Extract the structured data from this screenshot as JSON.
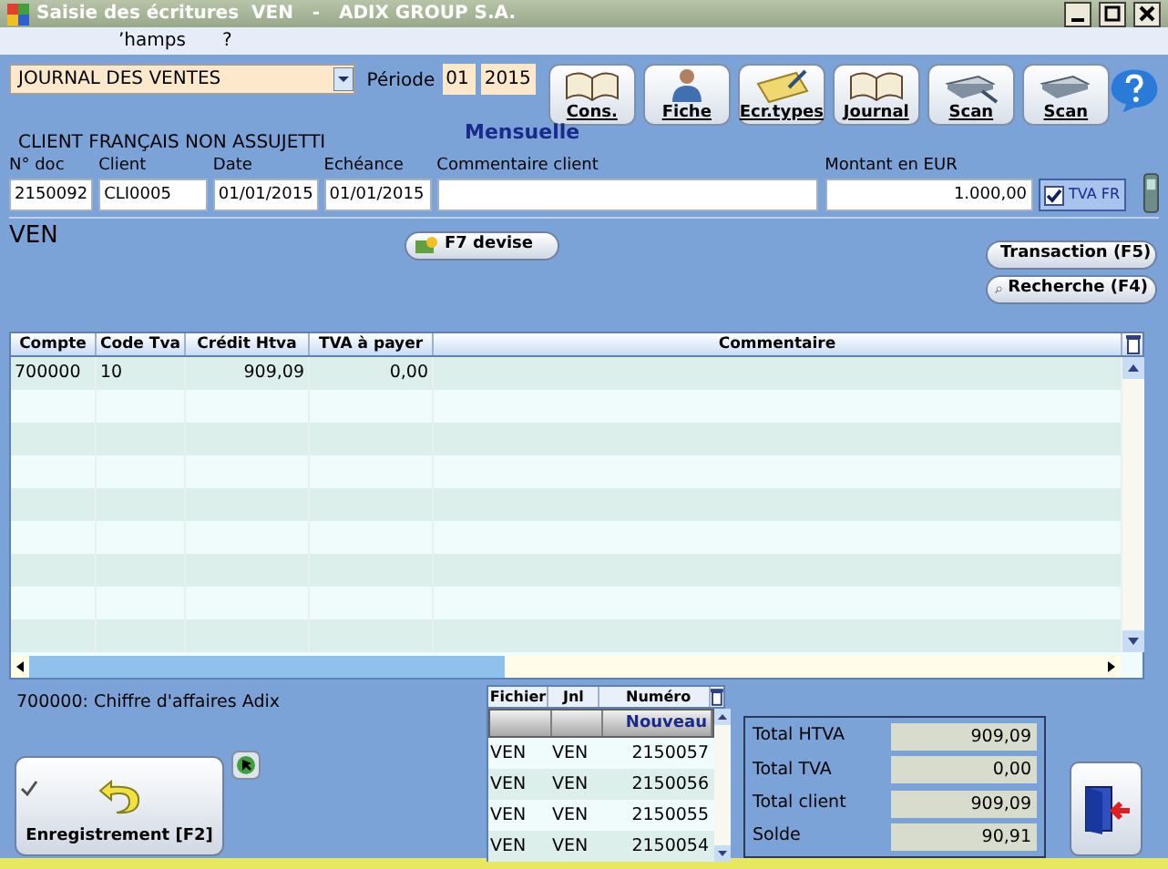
{
  "window": {
    "title": "Saisie des écritures  VEN   -   ADIX GROUP S.A."
  },
  "menu": [
    "ʼhamps",
    "?"
  ],
  "journal": {
    "value": "JOURNAL DES VENTES"
  },
  "periode": {
    "label": "Période",
    "month": "01",
    "year": "2015",
    "mode": "Mensuelle"
  },
  "toolbar": [
    {
      "label": "Cons.",
      "kind": "book"
    },
    {
      "label": "Fiche",
      "kind": "person"
    },
    {
      "label": "Ecr.types",
      "kind": "paper"
    },
    {
      "label": "Journal",
      "kind": "book"
    },
    {
      "label": "Scan",
      "kind": "scanpen"
    },
    {
      "label": "Scan",
      "kind": "scanner"
    }
  ],
  "client_type": "CLIENT FRANÇAIS NON ASSUJETTI",
  "fields": [
    {
      "label": "N° doc",
      "value": "2150092"
    },
    {
      "label": "Client",
      "value": "CLI0005"
    },
    {
      "label": "Date",
      "value": "01/01/2015"
    },
    {
      "label": "Echéance",
      "value": "01/01/2015"
    },
    {
      "label": "Commentaire client"
    },
    {
      "label": "Montant en EUR",
      "value": "1.000,00"
    }
  ],
  "tva_fr": {
    "label": "TVA FR",
    "checked": true
  },
  "section": "VEN",
  "f7_button": "F7 devise",
  "side_buttons": [
    "Transaction (F5)",
    "Recherche (F4)"
  ],
  "grid": {
    "columns": [
      "Compte",
      "Code Tva",
      "Crédit Htva",
      "TVA à payer",
      "Commentaire"
    ],
    "rows": [
      [
        "700000",
        "10",
        "909,09",
        "0,00",
        ""
      ]
    ]
  },
  "account_info": "700000: Chiffre d'affaires Adix",
  "save_button": "Enregistrement [F2]",
  "list": {
    "columns": [
      "Fichier",
      "Jnl",
      "Numéro"
    ],
    "new_label": "Nouveau",
    "rows": [
      [
        "VEN",
        "VEN",
        "2150057"
      ],
      [
        "VEN",
        "VEN",
        "2150056"
      ],
      [
        "VEN",
        "VEN",
        "2150055"
      ],
      [
        "VEN",
        "VEN",
        "2150054"
      ]
    ]
  },
  "totals": [
    {
      "label": "Total HTVA",
      "value": "909,09"
    },
    {
      "label": "Total TVA",
      "value": "0,00"
    },
    {
      "label": "Total client",
      "value": "909,09"
    },
    {
      "label": "Solde",
      "value": "90,91"
    }
  ]
}
